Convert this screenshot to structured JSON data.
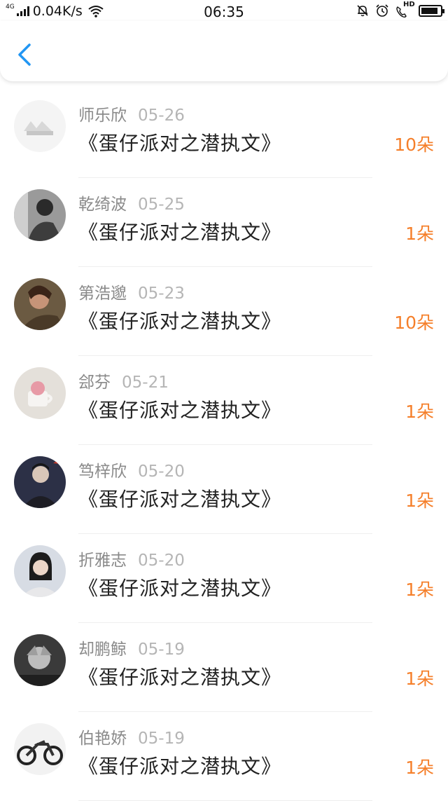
{
  "status_bar": {
    "network_type": "4G",
    "speed": "0.04K/s",
    "time": "06:35",
    "battery_level": 0.9,
    "hd_label": "HD"
  },
  "header": {
    "back_icon": "chevron-left-icon",
    "accent_color": "#2196f3"
  },
  "items": [
    {
      "name": "师乐欣",
      "date": "05-26",
      "title": "《蛋仔派对之潜执文》",
      "amount": "10朵"
    },
    {
      "name": "乾绮波",
      "date": "05-25",
      "title": "《蛋仔派对之潜执文》",
      "amount": "1朵"
    },
    {
      "name": "第浩邈",
      "date": "05-23",
      "title": "《蛋仔派对之潜执文》",
      "amount": "10朵"
    },
    {
      "name": "郐芬",
      "date": "05-21",
      "title": "《蛋仔派对之潜执文》",
      "amount": "1朵"
    },
    {
      "name": "笃梓欣",
      "date": "05-20",
      "title": "《蛋仔派对之潜执文》",
      "amount": "1朵"
    },
    {
      "name": "折雅志",
      "date": "05-20",
      "title": "《蛋仔派对之潜执文》",
      "amount": "1朵"
    },
    {
      "name": "却鹏鲸",
      "date": "05-19",
      "title": "《蛋仔派对之潜执文》",
      "amount": "1朵"
    },
    {
      "name": "伯艳娇",
      "date": "05-19",
      "title": "《蛋仔派对之潜执文》",
      "amount": "1朵"
    }
  ],
  "colors": {
    "amount": "#f57f2a",
    "name": "#8a8a8a",
    "date": "#b5b5b5",
    "title": "#222222"
  }
}
